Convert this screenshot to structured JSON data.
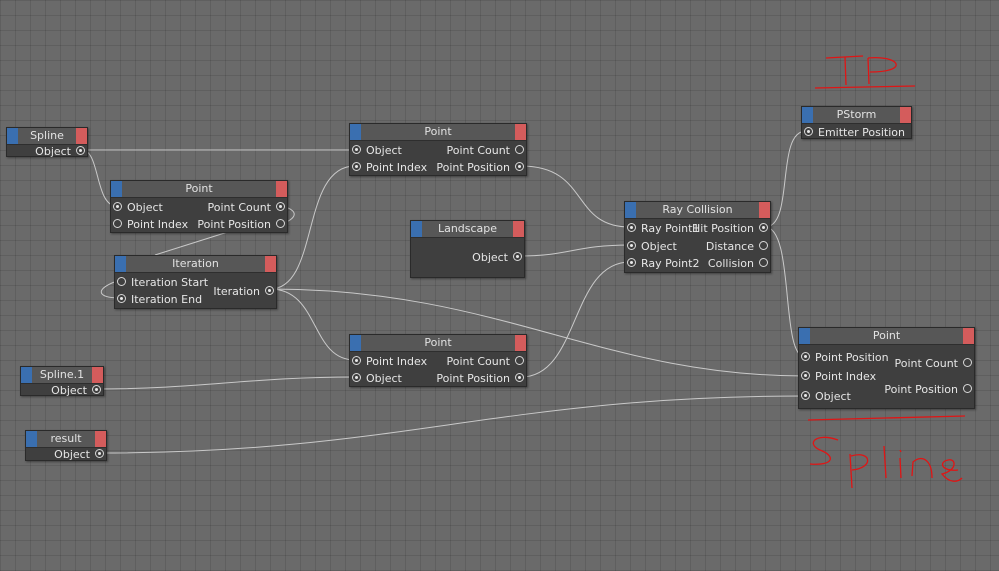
{
  "colors": {
    "background": "#6a6a6a",
    "node_body": "#3f3f3f",
    "node_title": "#575757",
    "input_cap": "#3a6fb0",
    "output_cap": "#d45c5c",
    "wire": "#c9c9c9",
    "annotation": "#e01515"
  },
  "annotations": {
    "top": "IP",
    "bottom": "Spline"
  },
  "nodes": {
    "spline": {
      "title": "Spline",
      "ports": {
        "object": "Object"
      }
    },
    "point1": {
      "title": "Point",
      "ports": {
        "object": "Object",
        "point_index": "Point Index",
        "point_count": "Point Count",
        "point_position": "Point Position"
      }
    },
    "point_top": {
      "title": "Point",
      "ports": {
        "object": "Object",
        "point_index": "Point Index",
        "point_count": "Point Count",
        "point_position": "Point Position"
      }
    },
    "iteration": {
      "title": "Iteration",
      "ports": {
        "iteration_start": "Iteration Start",
        "iteration_end": "Iteration End",
        "iteration": "Iteration"
      }
    },
    "landscape": {
      "title": "Landscape",
      "ports": {
        "object": "Object"
      }
    },
    "spline1": {
      "title": "Spline.1",
      "ports": {
        "object": "Object"
      }
    },
    "point_mid": {
      "title": "Point",
      "ports": {
        "point_index": "Point Index",
        "object": "Object",
        "point_count": "Point Count",
        "point_position": "Point Position"
      }
    },
    "result": {
      "title": "result",
      "ports": {
        "object": "Object"
      }
    },
    "ray_collision": {
      "title": "Ray Collision",
      "ports": {
        "ray_point1": "Ray Point1",
        "object": "Object",
        "ray_point2": "Ray Point2",
        "hit_position": "Hit Position",
        "distance": "Distance",
        "collision": "Collision"
      }
    },
    "pstorm": {
      "title": "PStorm",
      "ports": {
        "emitter_position": "Emitter Position"
      }
    },
    "point_out": {
      "title": "Point",
      "ports": {
        "point_position": "Point Position",
        "point_index": "Point Index",
        "object": "Object",
        "point_count": "Point Count",
        "point_position_out": "Point Position"
      }
    }
  }
}
